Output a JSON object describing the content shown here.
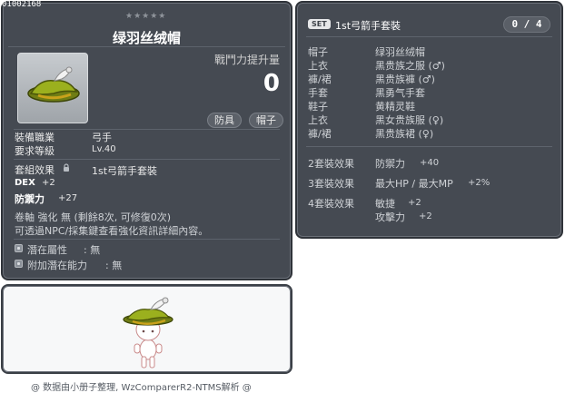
{
  "item_id": "01002168",
  "item": {
    "stars": "★★★★★",
    "name": "绿羽丝绒帽",
    "power_label": "戰鬥力提升量",
    "power_value": "0",
    "tag_type": "防具",
    "tag_slot": "帽子",
    "job_label": "裝備職業",
    "job_value": "弓手",
    "level_label": "要求等級",
    "level_value": "Lv.40",
    "set_label": "套組效果",
    "set_value": "1st弓箭手套裝",
    "stat1_name": "DEX",
    "stat1_value": "+2",
    "stat2_name": "防禦力",
    "stat2_value": "+27",
    "scroll_line": "卷軸 強化 無 (剩餘8次, 可修復0次)",
    "npc_line": "可透過NPC/採集鍵查看強化資訊詳細內容。",
    "potential_label": "潛在屬性",
    "potential_value": ": 無",
    "bonus_potential_label": "附加潛在能力",
    "bonus_potential_value": ": 無"
  },
  "set_panel": {
    "badge": "SET",
    "title": "1st弓箭手套裝",
    "counter": "0 / 4",
    "pieces": [
      {
        "slot": "帽子",
        "name": "绿羽丝绒帽"
      },
      {
        "slot": "上衣",
        "name": "黑贵族之服 (♂)"
      },
      {
        "slot": "褲/裙",
        "name": "黑贵族褲 (♂)"
      },
      {
        "slot": "手套",
        "name": "黑勇气手套"
      },
      {
        "slot": "鞋子",
        "name": "黄精灵鞋"
      },
      {
        "slot": "上衣",
        "name": "黑女贵族服 (♀)"
      },
      {
        "slot": "褲/裙",
        "name": "黑贵族裙 (♀)"
      }
    ],
    "effects": {
      "e2_label": "2套裝效果",
      "e2_stat": "防禦力",
      "e2_value": "+40",
      "e3_label": "3套裝效果",
      "e3_stat": "最大HP / 最大MP",
      "e3_value": "+2%",
      "e4_label": "4套裝效果",
      "e4_stat1": "敏捷",
      "e4_value1": "+2",
      "e4_stat2": "攻擊力",
      "e4_value2": "+2"
    }
  },
  "footer": "@ 数据由小册子整理, WzComparerR2-NTMS解析 @"
}
